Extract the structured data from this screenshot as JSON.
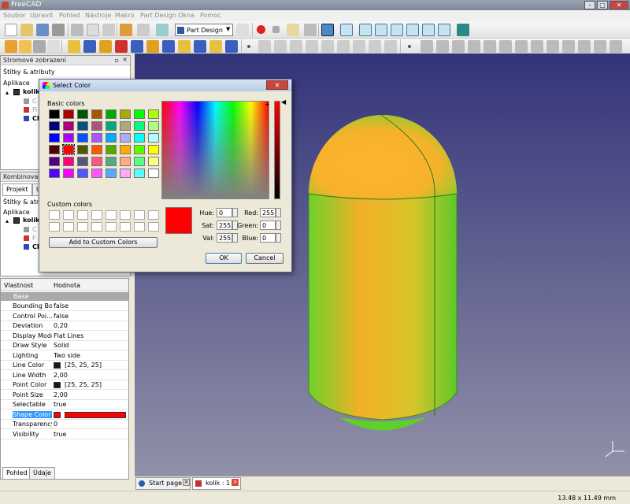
{
  "window": {
    "title": "FreeCAD"
  },
  "menu": [
    "Soubor",
    "Upravit",
    "Pohled",
    "Nástroje",
    "Makro",
    "Part Design",
    "Okna",
    "Pomoc"
  ],
  "toolbar": {
    "workbench": "Part Design"
  },
  "tree_panel": {
    "title": "Stromové zobrazení",
    "subtitle": "Štítky & atributy",
    "root": "Aplikace",
    "document": "kolik",
    "items": [
      "C",
      "Fi",
      "Ch"
    ]
  },
  "combo_panel": {
    "title": "Kombinované zo",
    "tabs": [
      "Projekt",
      "Ú"
    ],
    "subtitle": "Štítky & atributy",
    "root": "Aplikace",
    "document": "kolik",
    "items": [
      "C",
      "F",
      "Ch"
    ]
  },
  "properties": {
    "header_key": "Vlastnost",
    "header_value": "Hodnota",
    "group": "Base",
    "rows": [
      {
        "key": "Bounding Box",
        "value": "false"
      },
      {
        "key": "Control Poi...",
        "value": "false"
      },
      {
        "key": "Deviation",
        "value": "0,20"
      },
      {
        "key": "Display Mode",
        "value": "Flat Lines"
      },
      {
        "key": "Draw Style",
        "value": "Solid"
      },
      {
        "key": "Lighting",
        "value": "Two side"
      },
      {
        "key": "Line Color",
        "value": "[25, 25, 25]",
        "swatch": "#191919"
      },
      {
        "key": "Line Width",
        "value": "2,00"
      },
      {
        "key": "Point Color",
        "value": "[25, 25, 25]",
        "swatch": "#191919"
      },
      {
        "key": "Point Size",
        "value": "2,00"
      },
      {
        "key": "Selectable",
        "value": "true"
      },
      {
        "key": "Shape Color",
        "value": "",
        "swatch": "#ff0000",
        "selected": true
      },
      {
        "key": "Transparency",
        "value": "0"
      },
      {
        "key": "Visibility",
        "value": "true"
      }
    ],
    "bottom_tabs": [
      "Pohled",
      "Údaje"
    ]
  },
  "doc_tabs": [
    "Start page",
    "kolik : 1"
  ],
  "status": {
    "dimensions": "13.48 x 11.49 mm"
  },
  "dialog": {
    "title": "Select Color",
    "basic_label": "Basic colors",
    "custom_label": "Custom colors",
    "add_button": "Add to Custom Colors",
    "ok": "OK",
    "cancel": "Cancel",
    "fields": {
      "hue_label": "Hue:",
      "hue": "0",
      "sat_label": "Sat:",
      "sat": "255",
      "val_label": "Val:",
      "val": "255",
      "red_label": "Red:",
      "red": "255",
      "green_label": "Green:",
      "green": "0",
      "blue_label": "Blue:",
      "blue": "0"
    },
    "current_color": "#ff0000",
    "basic_colors": [
      "#000000",
      "#aa0000",
      "#005500",
      "#aa5500",
      "#00aa00",
      "#aaaa00",
      "#00ff00",
      "#aaff00",
      "#00007f",
      "#aa007f",
      "#00557f",
      "#aa557f",
      "#00aa7f",
      "#aaaa7f",
      "#00ff7f",
      "#aaff7f",
      "#0000ff",
      "#aa00ff",
      "#0055ff",
      "#aa55ff",
      "#00aaff",
      "#aaaaff",
      "#00ffff",
      "#aaffff",
      "#550000",
      "#ff0000",
      "#555500",
      "#ff5500",
      "#55aa00",
      "#ffaa00",
      "#55ff00",
      "#ffff00",
      "#55007f",
      "#ff007f",
      "#55557f",
      "#ff557f",
      "#55aa7f",
      "#ffaa7f",
      "#55ff7f",
      "#ffff7f",
      "#5500ff",
      "#ff00ff",
      "#5555ff",
      "#ff55ff",
      "#55aaff",
      "#ffaaff",
      "#55ffff",
      "#ffffff"
    ]
  }
}
